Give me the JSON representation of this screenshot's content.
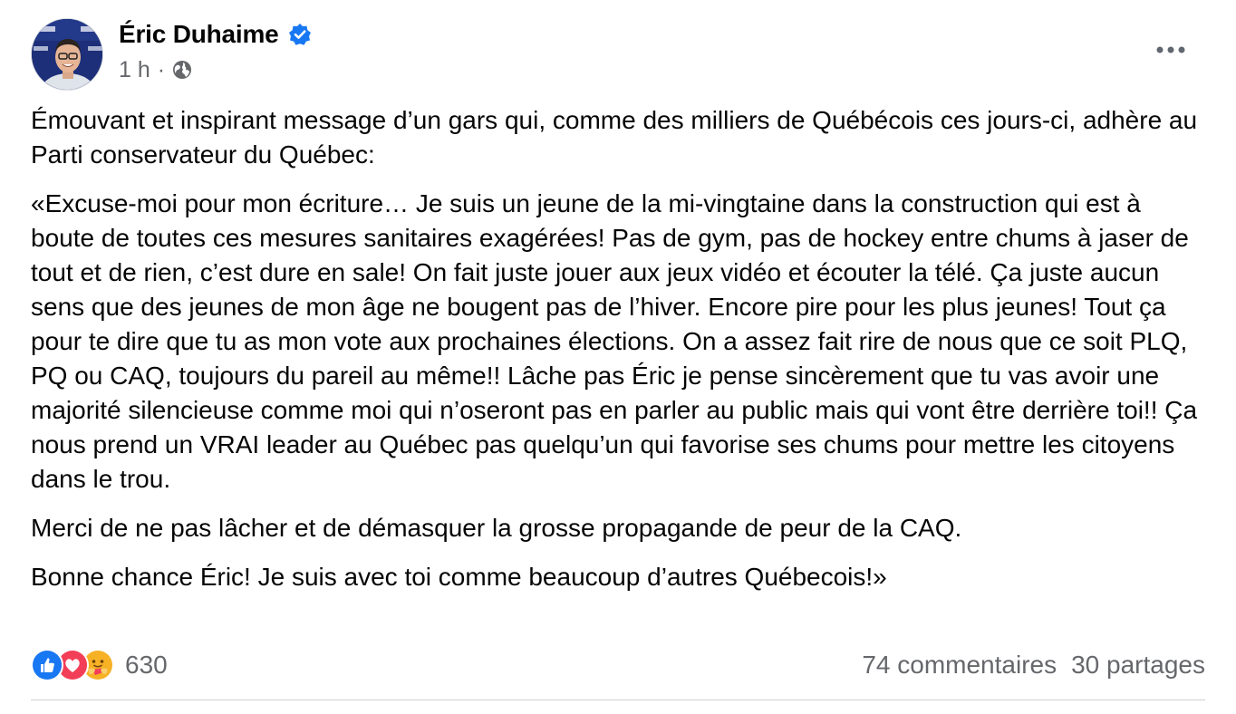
{
  "post": {
    "author": "Éric Duhaime",
    "time": "1 h",
    "separator": "·",
    "paragraphs": [
      "Émouvant et inspirant message d’un gars qui, comme des milliers de Québécois ces jours-ci, adhère au Parti conservateur du Québec:",
      "«Excuse-moi pour mon écriture… Je suis un jeune de la mi-vingtaine dans la construction qui est à boute de toutes ces mesures sanitaires exagérées! Pas de gym, pas de hockey entre chums à jaser de tout et de rien, c’est dure en sale! On fait juste jouer aux jeux vidéo et écouter la télé. Ça juste aucun sens que des jeunes de mon âge ne bougent pas de l’hiver. Encore pire pour les plus jeunes! Tout ça pour te dire que tu as mon vote aux prochaines élections.  On a assez fait rire de nous que ce soit PLQ, PQ ou CAQ, toujours du pareil au même!! Lâche pas Éric je pense sincèrement que tu vas avoir une majorité silencieuse comme moi qui n’oseront pas en parler au public mais qui vont être derrière toi!! Ça nous prend un VRAI leader au Québec pas quelqu’un qui favorise ses chums pour mettre les citoyens dans le trou.",
      "Merci de ne pas lâcher et de démasquer la grosse propagande de peur de la CAQ.",
      "Bonne chance Éric! Je suis avec toi comme beaucoup d’autres Québecois!»"
    ],
    "reactions": {
      "count": "630",
      "types": [
        "like-icon",
        "love-icon",
        "care-icon"
      ]
    },
    "comments": "74 commentaires",
    "shares": "30 partages"
  },
  "icons": {
    "verified": "verified-badge-icon",
    "audience": "globe-icon",
    "more": "more-options-icon"
  },
  "colors": {
    "verified": "#1877f2",
    "like": "#1877f2",
    "love": "#f33e58",
    "care": "#f7b125",
    "muted_text": "#65676b"
  }
}
